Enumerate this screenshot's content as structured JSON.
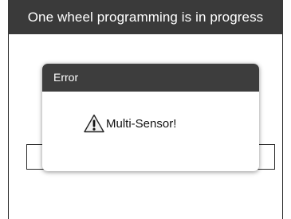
{
  "window": {
    "title": "One wheel programming is in progress"
  },
  "dialog": {
    "title": "Error",
    "message": "Multi-Sensor!",
    "icon": "warning-triangle-icon"
  },
  "colors": {
    "titlebar_bg": "#3a3a3a",
    "dialog_header_bg": "#3d3d3d",
    "text_light": "#ffffff"
  }
}
